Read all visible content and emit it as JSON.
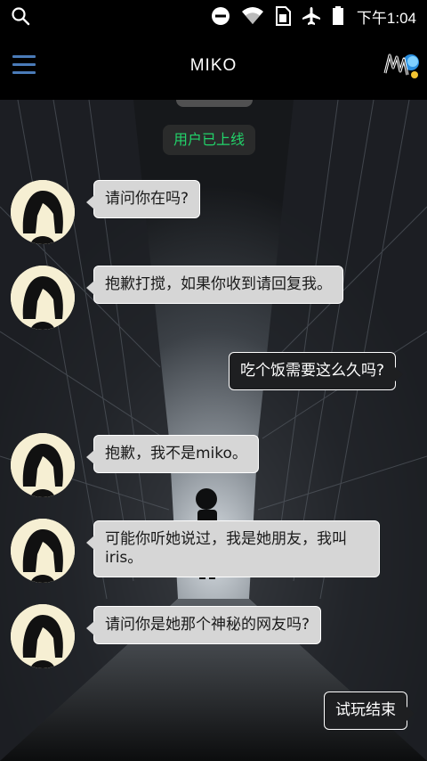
{
  "status_bar": {
    "time": "下午1:04",
    "icons": [
      "search-icon",
      "do-not-disturb-icon",
      "wifi-icon",
      "sim-card-icon",
      "airplane-mode-icon",
      "battery-icon"
    ]
  },
  "app_bar": {
    "title": "MIKO",
    "menu_icon": "hamburger-menu-icon",
    "logo": "game-logo"
  },
  "chat": {
    "system_message": "用户已上线",
    "messages": [
      {
        "direction": "in",
        "text": "请问你在吗?"
      },
      {
        "direction": "in",
        "text": "抱歉打搅，如果你收到请回复我。"
      },
      {
        "direction": "out",
        "text": "吃个饭需要这么久吗?"
      },
      {
        "direction": "in",
        "text": "抱歉，我不是miko。"
      },
      {
        "direction": "in",
        "text": "可能你听她说过，我是她朋友，我叫iris。"
      },
      {
        "direction": "in",
        "text": "请问你是她那个神秘的网友吗?"
      },
      {
        "direction": "out",
        "text": "试玩结束"
      }
    ]
  },
  "colors": {
    "system_text": "#22d36a",
    "incoming_bubble": "#d6d6d6",
    "outgoing_bubble": "#1e1f21",
    "menu_icon": "#4a7bb8",
    "avatar_bg": "#f6efd3"
  }
}
